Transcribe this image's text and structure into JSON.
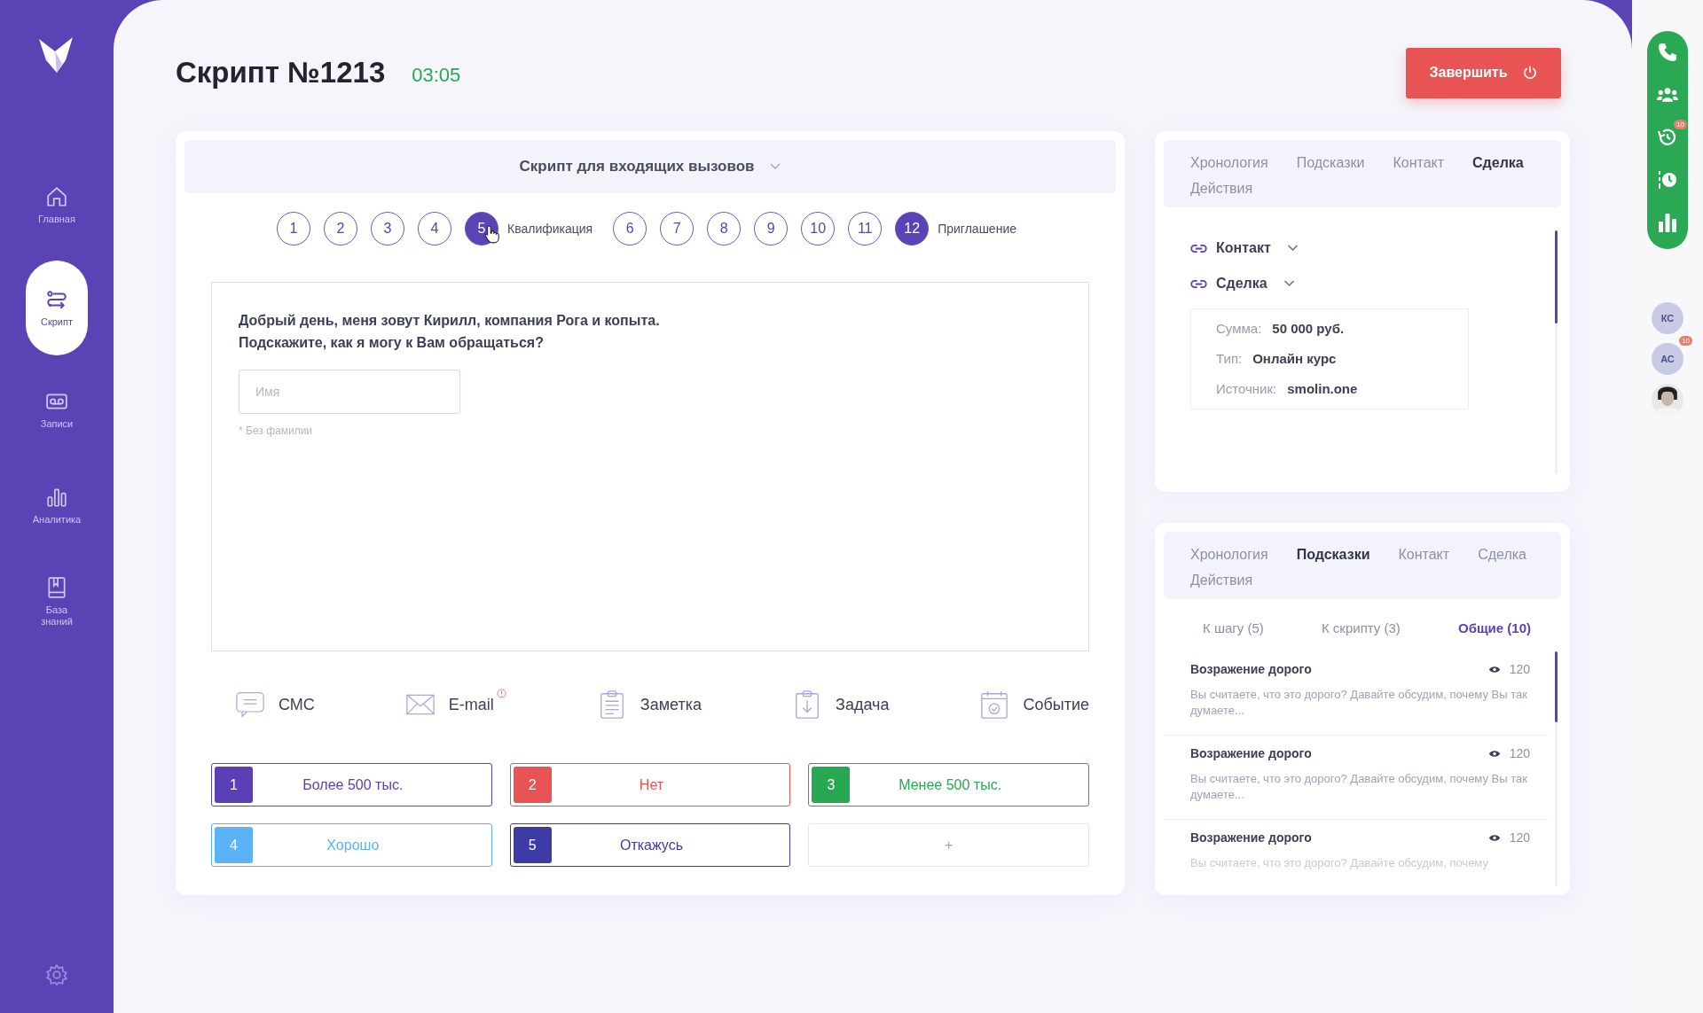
{
  "sidebar": {
    "items": [
      {
        "kind": "home",
        "label": "Главная",
        "selected": false
      },
      {
        "kind": "script",
        "label": "Скрипт",
        "selected": true
      },
      {
        "kind": "records",
        "label": "Записи",
        "selected": false
      },
      {
        "kind": "analytics",
        "label": "Аналитика",
        "selected": false
      },
      {
        "kind": "knowledge",
        "label": "База знаний",
        "selected": false
      }
    ]
  },
  "header": {
    "title": "Скрипт №1213",
    "timer": "03:05",
    "finish_button": "Завершить"
  },
  "script": {
    "title": "Скрипт для входящих вызовов",
    "steps": [
      {
        "number": "1",
        "selected": false
      },
      {
        "number": "2",
        "selected": false
      },
      {
        "number": "3",
        "selected": false
      },
      {
        "number": "4",
        "selected": false
      },
      {
        "number": "5",
        "selected": true,
        "label": "Квалификация"
      },
      {
        "number": "6",
        "selected": false
      },
      {
        "number": "7",
        "selected": false
      },
      {
        "number": "8",
        "selected": false
      },
      {
        "number": "9",
        "selected": false
      },
      {
        "number": "10",
        "selected": false
      },
      {
        "number": "11",
        "selected": false
      },
      {
        "number": "12",
        "selected": true,
        "label": "Приглашение"
      }
    ],
    "question_lines": [
      "Добрый день, меня зовут Кирилл, компания Рога и копыта.",
      "Подскажите, как я могу к Вам обращаться?"
    ],
    "name_field": {
      "placeholder": "Имя",
      "hint": "* Без фамилии"
    },
    "actions": [
      {
        "kind": "sms",
        "label": "СМС",
        "alert": false
      },
      {
        "kind": "email",
        "label": "E-mail",
        "alert": true
      },
      {
        "kind": "note",
        "label": "Заметка",
        "alert": false
      },
      {
        "kind": "task",
        "label": "Задача",
        "alert": false
      },
      {
        "kind": "event",
        "label": "Событие",
        "alert": false
      }
    ],
    "answers": [
      {
        "number": "1",
        "label": "Более 500 тыс.",
        "color": "#5b3fb4"
      },
      {
        "number": "2",
        "label": "Нет",
        "color": "#e85454"
      },
      {
        "number": "3",
        "label": "Менее 500 тыс.",
        "color": "#28a853"
      },
      {
        "number": "4",
        "label": "Хорошо",
        "color": "#5cb2f6"
      },
      {
        "number": "5",
        "label": "Откажусь",
        "color": "#3d3ba6"
      }
    ],
    "add_answer": "+"
  },
  "deal_panel": {
    "tabs": [
      {
        "label": "Хронология",
        "selected": false
      },
      {
        "label": "Подсказки",
        "selected": false
      },
      {
        "label": "Контакт",
        "selected": false
      },
      {
        "label": "Сделка",
        "selected": true
      },
      {
        "label": "Действия",
        "selected": false
      }
    ],
    "sections": [
      {
        "title": "Контакт"
      },
      {
        "title": "Сделка",
        "fields": [
          {
            "label": "Сумма:",
            "value": "50 000 руб."
          },
          {
            "label": "Тип:",
            "value": "Онлайн курс"
          },
          {
            "label": "Источник:",
            "value": "smolin.one"
          }
        ]
      }
    ]
  },
  "tips_panel": {
    "tabs": [
      {
        "label": "Хронология",
        "selected": false
      },
      {
        "label": "Подсказки",
        "selected": true
      },
      {
        "label": "Контакт",
        "selected": false
      },
      {
        "label": "Сделка",
        "selected": false
      },
      {
        "label": "Действия",
        "selected": false
      }
    ],
    "filters": [
      {
        "label": "К шагу (5)",
        "selected": false
      },
      {
        "label": "К скрипту (3)",
        "selected": false
      },
      {
        "label": "Общие (10)",
        "selected": true
      }
    ],
    "tips": [
      {
        "title": "Возражение дорого",
        "views": "120",
        "text": "Вы считаете, что это дорого? Давайте обсудим, почему Вы так думаете..."
      },
      {
        "title": "Возражение дорого",
        "views": "120",
        "text": "Вы считаете, что это дорого? Давайте обсудим, почему Вы так думаете..."
      },
      {
        "title": "Возражение дорого",
        "views": "120",
        "text": "Вы считаете, что это дорого? Давайте обсудим, почему"
      }
    ]
  },
  "rail": {
    "tools": [
      {
        "kind": "phone"
      },
      {
        "kind": "team"
      },
      {
        "kind": "history",
        "badge": "10"
      },
      {
        "kind": "timeline"
      },
      {
        "kind": "stats"
      }
    ],
    "avatars": [
      {
        "kind": "initials",
        "initials": "КС"
      },
      {
        "kind": "initials",
        "initials": "АС",
        "badge": "10"
      },
      {
        "kind": "picture"
      }
    ]
  }
}
